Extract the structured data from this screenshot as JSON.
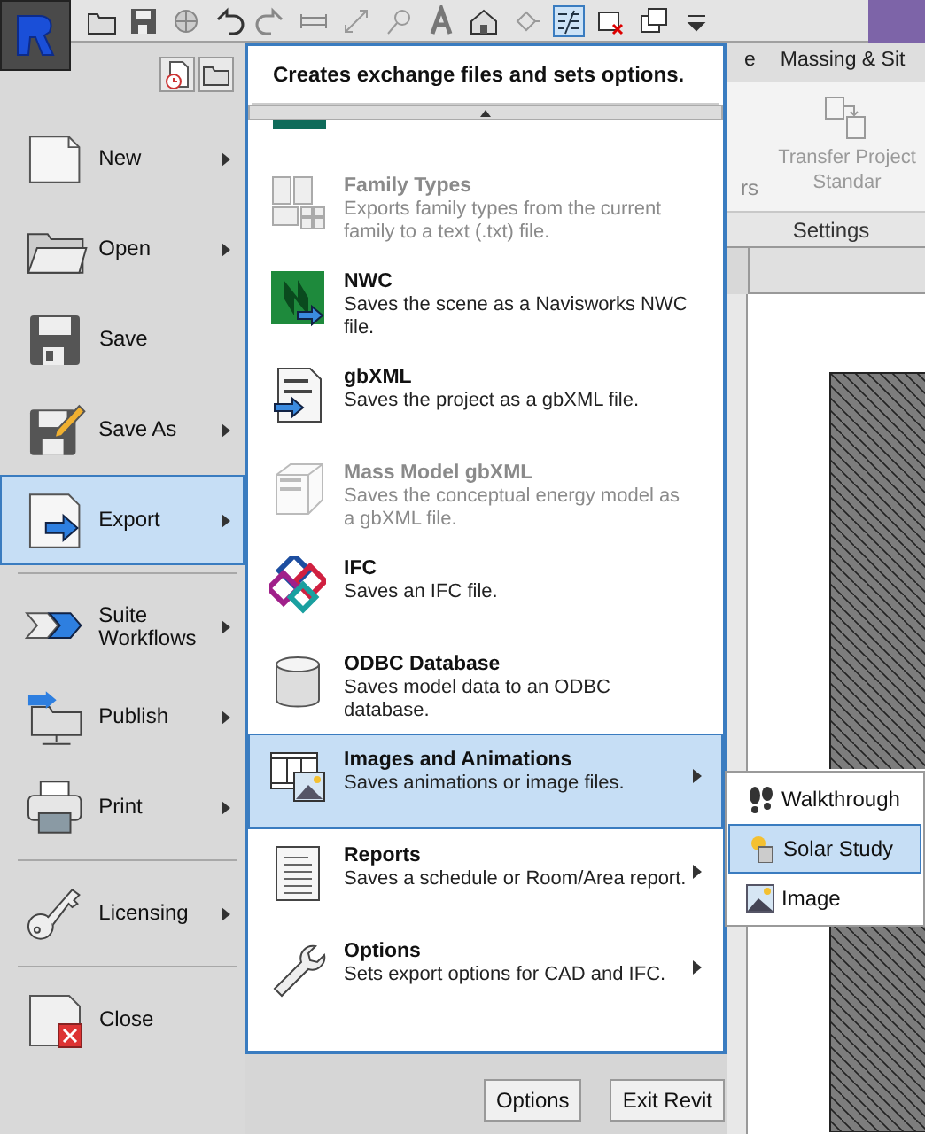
{
  "ribbon": {
    "tabs": [
      "e",
      "Massing & Sit"
    ],
    "partial_label": "rs",
    "tool": {
      "label": "Transfer Project Standar",
      "disabled": true
    },
    "panel_title": "Settings"
  },
  "app_menu": {
    "items": [
      {
        "label": "New",
        "has_submenu": true,
        "selected": false,
        "divider_after": false
      },
      {
        "label": "Open",
        "has_submenu": true,
        "selected": false,
        "divider_after": false
      },
      {
        "label": "Save",
        "has_submenu": false,
        "selected": false,
        "divider_after": false
      },
      {
        "label": "Save As",
        "has_submenu": true,
        "selected": false,
        "divider_after": false
      },
      {
        "label": "Export",
        "has_submenu": true,
        "selected": true,
        "divider_after": true
      },
      {
        "label": "Suite Workflows",
        "has_submenu": true,
        "selected": false,
        "divider_after": false
      },
      {
        "label": "Publish",
        "has_submenu": true,
        "selected": false,
        "divider_after": false
      },
      {
        "label": "Print",
        "has_submenu": true,
        "selected": false,
        "divider_after": true
      },
      {
        "label": "Licensing",
        "has_submenu": true,
        "selected": false,
        "divider_after": true
      },
      {
        "label": "Close",
        "has_submenu": false,
        "selected": false,
        "divider_after": false
      }
    ],
    "export_panel": {
      "header": "Creates exchange files and sets options.",
      "items": [
        {
          "title": "Family Types",
          "description": "Exports family types from the current family to a text (.txt) file.",
          "disabled": true,
          "selected": false,
          "has_submenu": false
        },
        {
          "title": "NWC",
          "description": "Saves the scene as a Navisworks NWC file.",
          "disabled": false,
          "selected": false,
          "has_submenu": false
        },
        {
          "title": "gbXML",
          "description": "Saves the project as a gbXML file.",
          "disabled": false,
          "selected": false,
          "has_submenu": false
        },
        {
          "title": "Mass Model gbXML",
          "description": "Saves the conceptual energy model as a gbXML file.",
          "disabled": true,
          "selected": false,
          "has_submenu": false
        },
        {
          "title": "IFC",
          "description": "Saves an IFC file.",
          "disabled": false,
          "selected": false,
          "has_submenu": false
        },
        {
          "title": "ODBC Database",
          "description": "Saves model data to an ODBC database.",
          "disabled": false,
          "selected": false,
          "has_submenu": false
        },
        {
          "title": "Images and Animations",
          "description": "Saves animations or image files.",
          "disabled": false,
          "selected": true,
          "has_submenu": true
        },
        {
          "title": "Reports",
          "description": "Saves a schedule or Room/Area report.",
          "disabled": false,
          "selected": false,
          "has_submenu": true
        },
        {
          "title": "Options",
          "description": "Sets export options for CAD and IFC.",
          "disabled": false,
          "selected": false,
          "has_submenu": true
        }
      ]
    },
    "submenu": {
      "items": [
        {
          "label": "Walkthrough",
          "selected": false
        },
        {
          "label": "Solar Study",
          "selected": true
        },
        {
          "label": "Image",
          "selected": false
        }
      ]
    },
    "buttons": [
      "Options",
      "Exit Revit"
    ]
  }
}
